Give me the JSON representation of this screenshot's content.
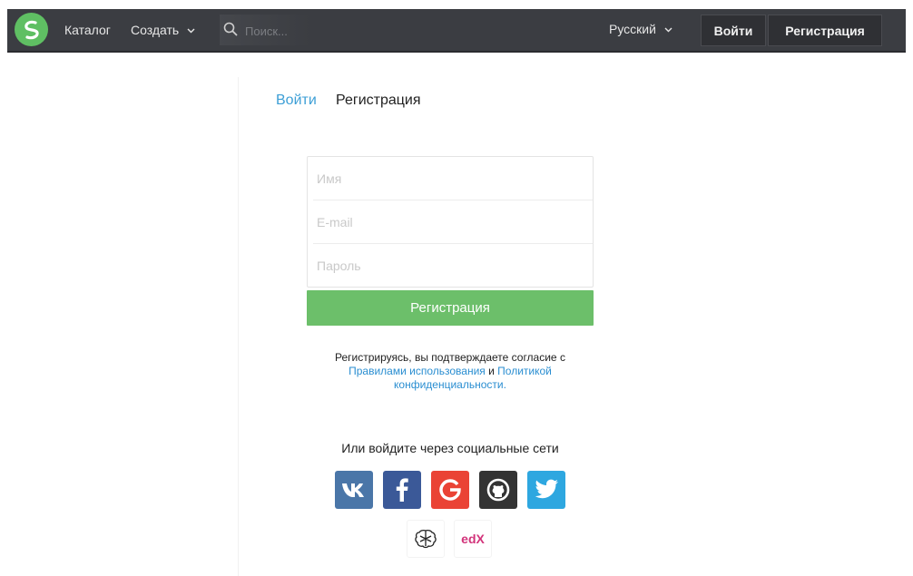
{
  "header": {
    "nav": {
      "catalog": "Каталог",
      "create": "Создать"
    },
    "search": {
      "placeholder": "Поиск..."
    },
    "language": "Русский",
    "login_button": "Войти",
    "register_button": "Регистрация"
  },
  "tabs": {
    "login": "Войти",
    "register": "Регистрация"
  },
  "form": {
    "name_placeholder": "Имя",
    "email_placeholder": "E-mail",
    "password_placeholder": "Пароль",
    "submit_label": "Регистрация"
  },
  "terms": {
    "text_before": "Регистрируясь, вы подтверждаете согласие с",
    "rules_link": "Правилами использования",
    "and": "и",
    "policy_link_1": "Политикой",
    "policy_link_2": "конфиденциальности"
  },
  "social": {
    "title": "Или войдите через социальные сети",
    "providers": [
      {
        "name": "vk",
        "icon": "vk-icon",
        "color": "#4a76a8"
      },
      {
        "name": "facebook",
        "icon": "facebook-icon",
        "color": "#3b5998"
      },
      {
        "name": "google",
        "icon": "google-icon",
        "color": "#ea4335"
      },
      {
        "name": "github",
        "icon": "github-icon",
        "color": "#333333"
      },
      {
        "name": "twitter",
        "icon": "twitter-icon",
        "color": "#2ea7e0"
      },
      {
        "name": "brain",
        "icon": "brain-icon",
        "color": "#ffffff"
      },
      {
        "name": "edx",
        "icon": "edx-icon",
        "color": "#ffffff"
      }
    ],
    "edx_text": "edX"
  },
  "colors": {
    "brand_green": "#6cbf6a",
    "link_blue": "#3d9fd6",
    "topbar": "#3b3d42"
  }
}
